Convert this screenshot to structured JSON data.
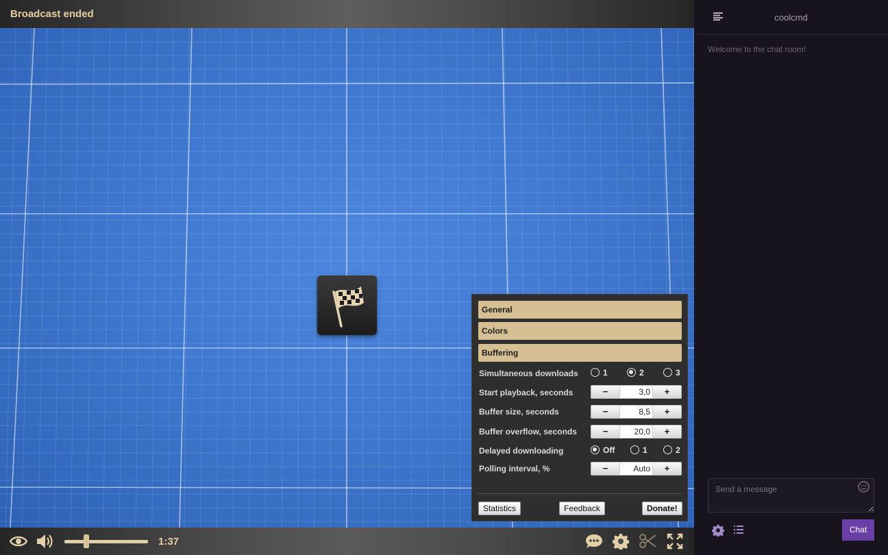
{
  "player": {
    "title": "Broadcast ended",
    "end_icon": "checkered-flag-icon",
    "elapsed": "1:37",
    "volume_level": 0.26,
    "controls": [
      "eye-icon",
      "speaker-icon",
      "chat-bubble-icon",
      "gear-icon",
      "scissors-icon",
      "fullscreen-icon"
    ]
  },
  "settings": {
    "sections": [
      "General",
      "Colors",
      "Buffering"
    ],
    "rows": {
      "simultaneous": {
        "label": "Simultaneous downloads",
        "options": [
          "1",
          "2",
          "3"
        ],
        "selected": "2"
      },
      "start": {
        "label": "Start playback, seconds",
        "value": "3,0"
      },
      "buffer": {
        "label": "Buffer size, seconds",
        "value": "8,5"
      },
      "overflow": {
        "label": "Buffer overflow, seconds",
        "value": "20,0"
      },
      "delayed": {
        "label": "Delayed downloading",
        "options": [
          "Off",
          "1",
          "2"
        ],
        "selected": "Off"
      },
      "polling": {
        "label": "Polling interval, %",
        "value": "Auto"
      }
    },
    "stepper_minus": "−",
    "stepper_plus": "+",
    "buttons": {
      "statistics": "Statistics",
      "feedback": "Feedback",
      "donate": "Donate!"
    }
  },
  "chat": {
    "username": "coolcmd",
    "welcome": "Welcome to the chat room!",
    "input_placeholder": "Send a message",
    "send_label": "Chat",
    "accent_color": "#6b3fa8"
  }
}
